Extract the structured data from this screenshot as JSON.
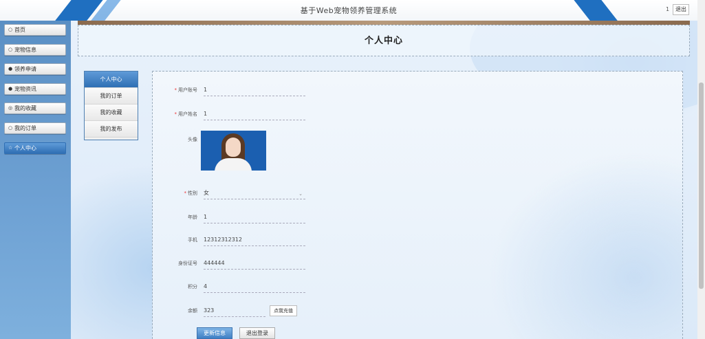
{
  "header": {
    "title": "基于Web宠物领养管理系统",
    "user_num": "1",
    "logout_label": "退出"
  },
  "sidebar": {
    "items": [
      {
        "icon": "○",
        "label": "首页"
      },
      {
        "icon": "○",
        "label": "宠物信息"
      },
      {
        "icon": "●",
        "label": "领养申请"
      },
      {
        "icon": "●",
        "label": "宠物资讯"
      },
      {
        "icon": "◎",
        "label": "我的收藏"
      },
      {
        "icon": "○",
        "label": "我的订单"
      },
      {
        "icon": "☆",
        "label": "个人中心"
      }
    ]
  },
  "page": {
    "title": "个人中心"
  },
  "submenu": {
    "items": [
      "个人中心",
      "我的订单",
      "我的收藏",
      "我的发布"
    ]
  },
  "form": {
    "account_label": "用户账号",
    "account_value": "1",
    "name_label": "用户姓名",
    "name_value": "1",
    "avatar_label": "头像",
    "gender_label": "性别",
    "gender_value": "女",
    "age_label": "年龄",
    "age_value": "1",
    "phone_label": "手机",
    "phone_value": "12312312312",
    "id_label": "身份证号",
    "id_value": "444444",
    "vip_label": "积分",
    "vip_value": "4",
    "balance_label": "余额",
    "balance_value": "323",
    "recharge_label": "点我充值",
    "update_label": "更新信息",
    "exit_label": "退出登录"
  }
}
